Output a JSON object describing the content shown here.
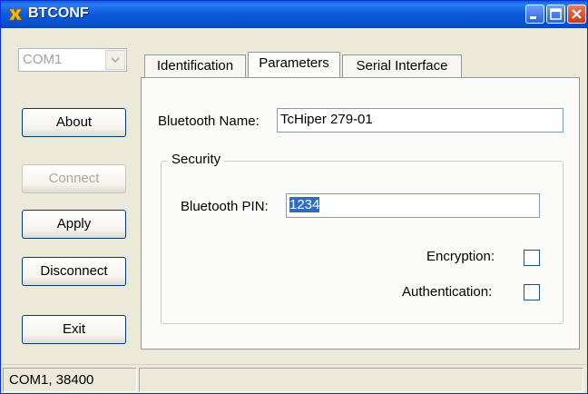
{
  "window": {
    "title": "BTCONF",
    "app_icon": "bluetooth-app-icon",
    "controls": [
      "minimize-icon",
      "maximize-icon",
      "close-icon"
    ]
  },
  "left_panel": {
    "port_select": {
      "value": "COM1",
      "enabled": false
    },
    "buttons": {
      "about": "About",
      "connect": "Connect",
      "apply": "Apply",
      "disconnect": "Disconnect",
      "exit": "Exit"
    }
  },
  "tabs": [
    {
      "label": "Identification",
      "active": false
    },
    {
      "label": "Parameters",
      "active": true
    },
    {
      "label": "Serial Interface",
      "active": false
    }
  ],
  "parameters": {
    "bluetooth_name_label": "Bluetooth Name:",
    "bluetooth_name_value": "TcHiper 279-01",
    "security": {
      "title": "Security",
      "pin_label": "Bluetooth PIN:",
      "pin_value": "1234",
      "encryption_label": "Encryption:",
      "encryption_checked": false,
      "authentication_label": "Authentication:",
      "authentication_checked": false
    }
  },
  "statusbar": {
    "connection": "COM1, 38400",
    "message": ""
  },
  "colors": {
    "titlebar": "#0a5ad8",
    "face": "#ece9d8",
    "selection": "#316ac5"
  }
}
